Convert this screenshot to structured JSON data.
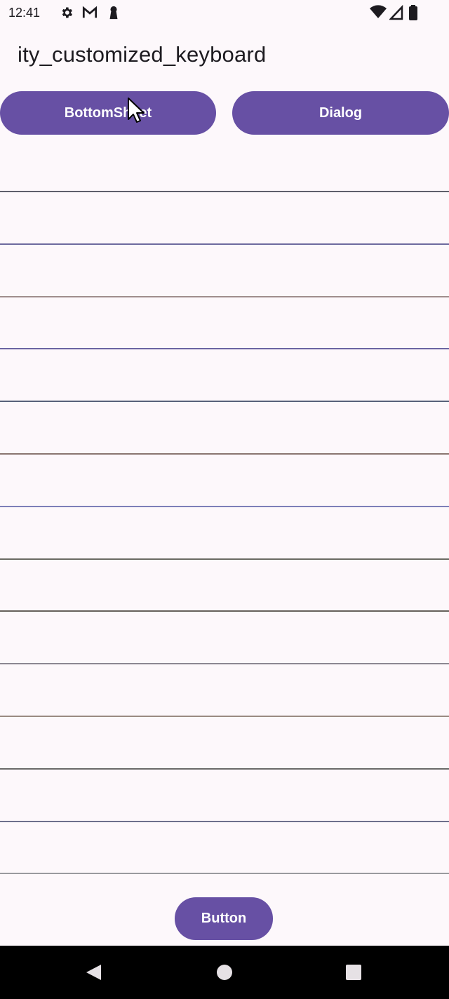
{
  "status_bar": {
    "time": "12:41",
    "left_icons": [
      "settings-icon",
      "gmail-icon",
      "keyhole-icon"
    ],
    "right_icons": [
      "wifi-icon",
      "signal-icon",
      "battery-icon"
    ]
  },
  "header": {
    "title": "ity_customized_keyboard"
  },
  "actions": {
    "bottom_sheet_label": "BottomSheet",
    "dialog_label": "Dialog"
  },
  "fields": {
    "count": 14,
    "underline_colors": [
      "#5f5f6b",
      "#6e6a9e",
      "#a08d8d",
      "#6b64a2",
      "#58627a",
      "#8a7670",
      "#7d7fb8",
      "#6a6a62",
      "#66615b",
      "#8c8791",
      "#9a8a82",
      "#6a6968",
      "#6d6f8c",
      "#9a9a9e"
    ],
    "values": [
      "",
      "",
      "",
      "",
      "",
      "",
      "",
      "",
      "",
      "",
      "",
      "",
      "",
      ""
    ]
  },
  "footer": {
    "button_label": "Button"
  },
  "colors": {
    "primary": "#6750a4",
    "on_primary": "#ffffff",
    "background": "#fdf8fb",
    "nav_bar": "#000000"
  },
  "nav_bar": {
    "buttons": [
      "back-icon",
      "home-icon",
      "recents-icon"
    ]
  }
}
